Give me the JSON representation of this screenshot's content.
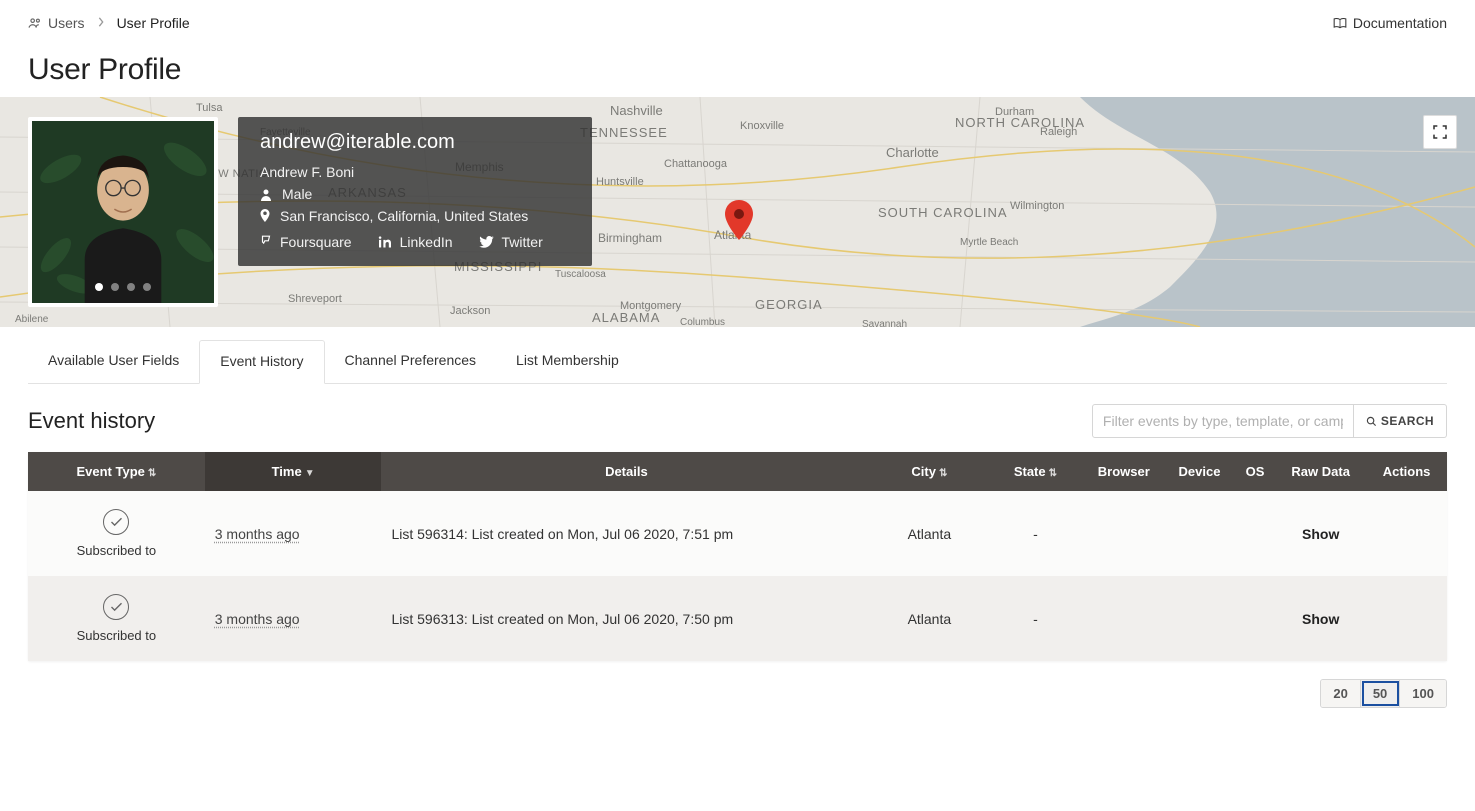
{
  "breadcrumb": {
    "root": "Users",
    "current": "User Profile"
  },
  "doc_link": "Documentation",
  "page_title": "User Profile",
  "profile": {
    "email": "andrew@iterable.com",
    "name": "Andrew F. Boni",
    "gender": "Male",
    "location": "San Francisco, California, United States",
    "links": {
      "foursquare": "Foursquare",
      "linkedin": "LinkedIn",
      "twitter": "Twitter"
    }
  },
  "map": {
    "labels": [
      "Nashville",
      "Knoxville",
      "NORTH CAROLINA",
      "Charlotte",
      "Durham",
      "Raleigh",
      "SOUTH CAROLINA",
      "Myrtle Beach",
      "Wilmington",
      "GEORGIA",
      "Atlanta",
      "Chattanooga",
      "Huntsville",
      "Birmingham",
      "Montgomery",
      "Tuscaloosa",
      "ALABAMA",
      "MISSISSIPPI",
      "Jackson",
      "Shreveport",
      "ARKANSAS",
      "Memphis",
      "Tulsa",
      "Fayetteville",
      "CHOCTAW NATION",
      "TENNESSEE",
      "Savannah",
      "Columbus",
      "Abilene"
    ]
  },
  "tabs": [
    {
      "id": "available",
      "label": "Available User Fields",
      "active": false
    },
    {
      "id": "history",
      "label": "Event History",
      "active": true
    },
    {
      "id": "channel",
      "label": "Channel Preferences",
      "active": false
    },
    {
      "id": "list",
      "label": "List Membership",
      "active": false
    }
  ],
  "section_title": "Event history",
  "search": {
    "placeholder": "Filter events by type, template, or campaign",
    "button": "SEARCH"
  },
  "table": {
    "columns": [
      "Event Type",
      "Time",
      "Details",
      "City",
      "State",
      "Browser",
      "Device",
      "OS",
      "Raw Data",
      "Actions"
    ],
    "rows": [
      {
        "event_type": "Subscribed to",
        "time": "3 months ago",
        "details": "List 596314: List created on Mon, Jul 06 2020, 7:51 pm",
        "city": "Atlanta",
        "state": "-",
        "browser": "",
        "device": "",
        "os": "",
        "raw": "Show"
      },
      {
        "event_type": "Subscribed to",
        "time": "3 months ago",
        "details": "List 596313: List created on Mon, Jul 06 2020, 7:50 pm",
        "city": "Atlanta",
        "state": "-",
        "browser": "",
        "device": "",
        "os": "",
        "raw": "Show"
      }
    ]
  },
  "page_sizes": {
    "options": [
      "20",
      "50",
      "100"
    ],
    "active": "50"
  }
}
